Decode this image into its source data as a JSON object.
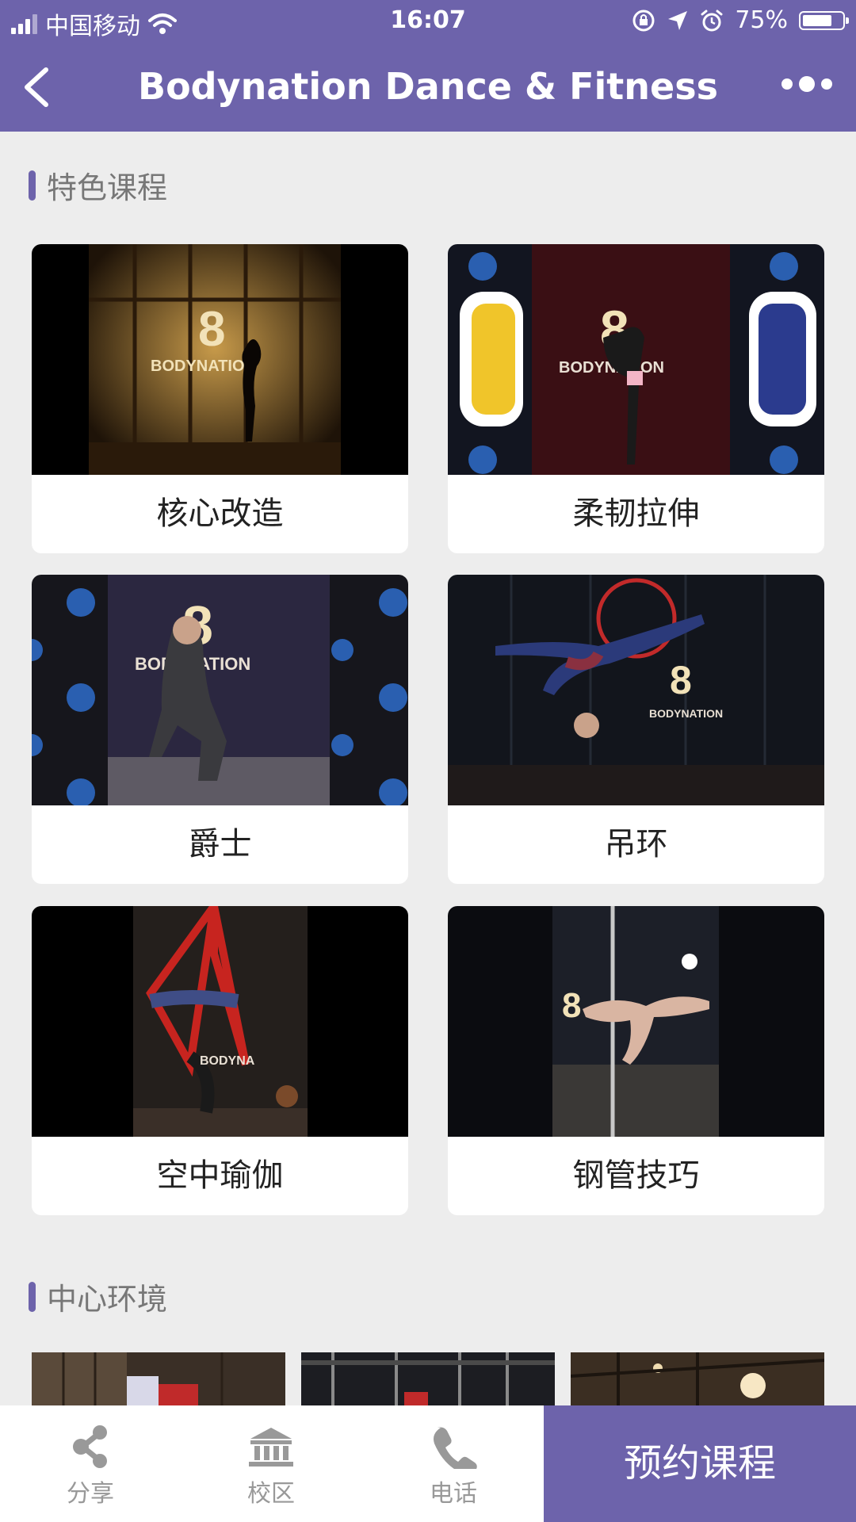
{
  "status_bar": {
    "carrier": "中国移动",
    "time": "16:07",
    "battery": "75%",
    "battery_level": 0.75
  },
  "nav": {
    "title": "Bodynation Dance & Fitness"
  },
  "featured": {
    "title": "特色课程",
    "courses": [
      {
        "label": "核心改造"
      },
      {
        "label": "柔韧拉伸"
      },
      {
        "label": "爵士"
      },
      {
        "label": "吊环"
      },
      {
        "label": "空中瑜伽"
      },
      {
        "label": "钢管技巧"
      }
    ]
  },
  "environment": {
    "title": "中心环境"
  },
  "tabbar": {
    "share": "分享",
    "campus": "校区",
    "phone": "电话",
    "book": "预约课程"
  },
  "colors": {
    "brand": "#6d63ab",
    "background": "#ededed"
  }
}
